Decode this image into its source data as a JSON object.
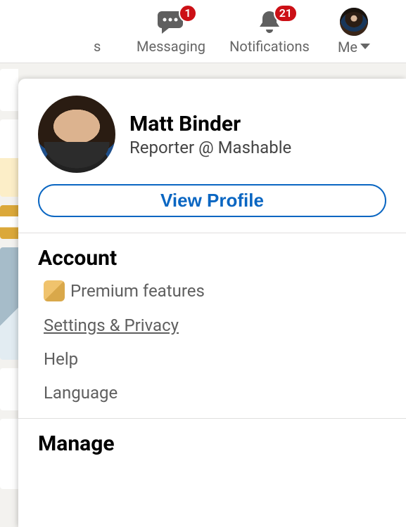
{
  "nav": {
    "partial_left_label": "s",
    "messaging": {
      "label": "Messaging",
      "badge": "1"
    },
    "notifications": {
      "label": "Notifications",
      "badge": "21"
    },
    "me": {
      "label": "Me"
    }
  },
  "dropdown": {
    "profile": {
      "name": "Matt Binder",
      "subtitle": "Reporter @ Mashable"
    },
    "view_profile_label": "View Profile",
    "sections": {
      "account": {
        "heading": "Account",
        "items": {
          "premium": "Premium features",
          "settings_privacy": "Settings & Privacy",
          "help": "Help",
          "language": "Language"
        }
      },
      "manage": {
        "heading": "Manage"
      }
    }
  }
}
